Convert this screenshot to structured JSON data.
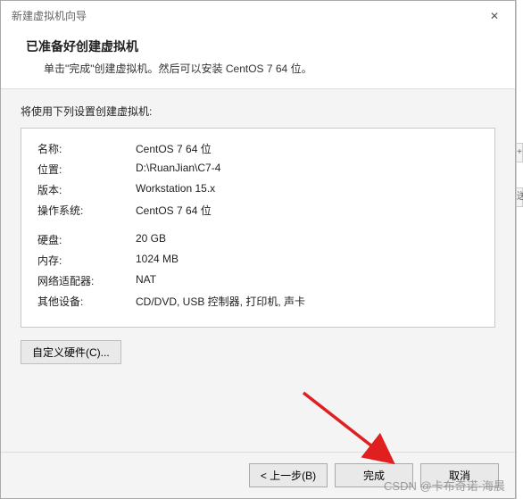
{
  "titlebar": {
    "title": "新建虚拟机向导",
    "close_icon": "✕"
  },
  "header": {
    "heading": "已准备好创建虚拟机",
    "description": "单击\"完成\"创建虚拟机。然后可以安装 CentOS 7 64 位。"
  },
  "content": {
    "intro": "将使用下列设置创建虚拟机:",
    "rows_a": [
      {
        "label": "名称:",
        "value": "CentOS 7 64 位"
      },
      {
        "label": "位置:",
        "value": "D:\\RuanJian\\C7-4"
      },
      {
        "label": "版本:",
        "value": "Workstation 15.x"
      },
      {
        "label": "操作系统:",
        "value": "CentOS 7 64 位"
      }
    ],
    "rows_b": [
      {
        "label": "硬盘:",
        "value": "20 GB"
      },
      {
        "label": "内存:",
        "value": "1024 MB"
      },
      {
        "label": "网络适配器:",
        "value": "NAT"
      },
      {
        "label": "其他设备:",
        "value": "CD/DVD, USB 控制器, 打印机, 声卡"
      }
    ],
    "customize_label": "自定义硬件(C)..."
  },
  "footer": {
    "back_label": "< 上一步(B)",
    "finish_label": "完成",
    "cancel_label": "取消"
  },
  "edge": {
    "btn1": "+",
    "btn2": "送"
  },
  "watermark": "CSDN @卡布奇诺·海晨"
}
